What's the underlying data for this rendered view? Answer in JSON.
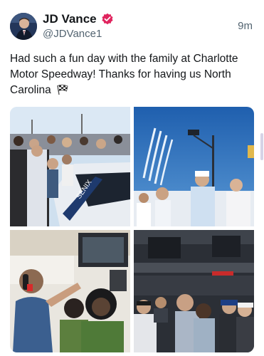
{
  "tweet": {
    "author_name": "JD Vance",
    "author_handle": "@JDVance1",
    "timestamp": "9m",
    "verified_icon": "verified-badge-icon",
    "text": "Had such a fun day with the family at Charlotte Motor Speedway! Thanks for having us North Carolina",
    "emoji_icon": "checkered-flag-icon",
    "photos": [
      {
        "icon": "photo-race-car-crowd"
      },
      {
        "icon": "photo-flyover-anthem"
      },
      {
        "icon": "photo-pit-box-headsets"
      },
      {
        "icon": "photo-crowd-family"
      }
    ]
  },
  "colors": {
    "verified_badge": "#e0245e",
    "text_primary": "#14171a",
    "text_secondary": "#536471"
  }
}
